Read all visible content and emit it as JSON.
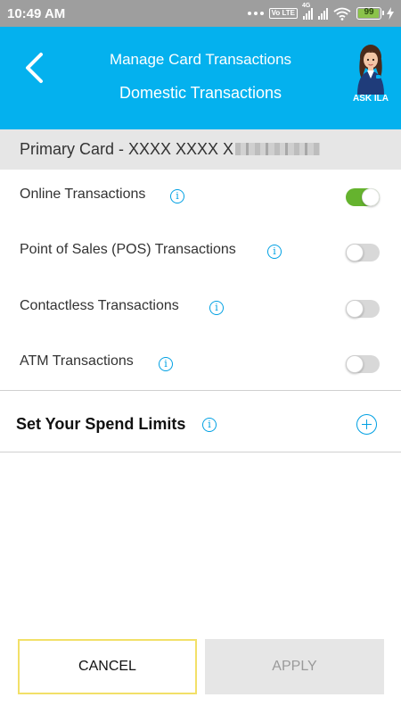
{
  "status_bar": {
    "time": "10:49 AM",
    "network_tag": "4G",
    "volte_label": "Vo LTE",
    "battery_percent": "99",
    "icons": [
      "notification-dots-icon",
      "volte-icon",
      "signal-icon",
      "signal-icon",
      "wifi-icon",
      "battery-icon",
      "charging-icon"
    ]
  },
  "header": {
    "title": "Manage Card Transactions",
    "subtitle": "Domestic Transactions",
    "back_icon": "chevron-left-icon",
    "assistant_label": "ASK ILA",
    "background_color": "#04b1ee"
  },
  "card": {
    "label": "Primary Card - XXXX XXXX X"
  },
  "transactions": [
    {
      "label": "Online Transactions",
      "enabled": true
    },
    {
      "label": "Point of Sales (POS) Transactions",
      "enabled": false
    },
    {
      "label": "Contactless Transactions",
      "enabled": false
    },
    {
      "label": "ATM Transactions",
      "enabled": false
    }
  ],
  "info_icon_glyph": "i",
  "spend_limits": {
    "label": "Set Your Spend Limits"
  },
  "buttons": {
    "cancel": "CANCEL",
    "apply": "APPLY"
  },
  "colors": {
    "accent": "#00a0e3",
    "toggle_on": "#65b32e",
    "toggle_off": "#d8d8d8",
    "cancel_border": "#f2e068"
  }
}
